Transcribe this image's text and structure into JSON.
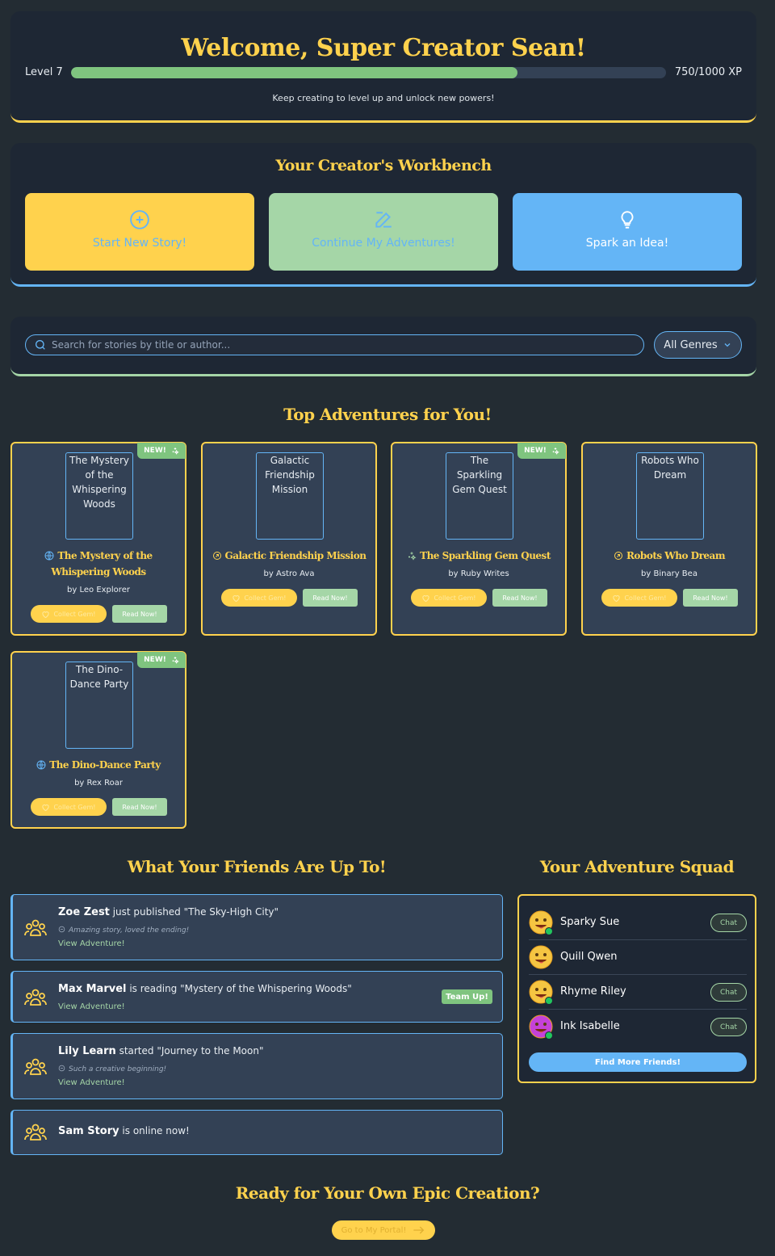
{
  "hero": {
    "title": "Welcome, Super Creator Sean!",
    "level": "Level 7",
    "xp_text": "750/1000 XP",
    "xp_fraction": 0.75,
    "subtitle": "Keep creating to level up and unlock new powers!"
  },
  "workbench": {
    "title": "Your Creator's Workbench",
    "start_label": "Start New Story!",
    "continue_label": "Continue My Adventures!",
    "spark_label": "Spark an Idea!"
  },
  "search": {
    "placeholder": "Search for stories by title or author...",
    "genre": "All Genres"
  },
  "stories": {
    "title": "Top Adventures for You!",
    "new_label": "NEW!",
    "collect_label": "Collect Gem!",
    "read_label": "Read Now!",
    "items": [
      {
        "cover_alt": "The Mystery of the Whispering Woods",
        "title": "The Mystery of the Whispering Woods",
        "author": "by Leo Explorer",
        "is_new": true,
        "icon": "globe-icon"
      },
      {
        "cover_alt": "Galactic Friendship Mission",
        "title": "Galactic Friendship Mission",
        "author": "by Astro Ava",
        "is_new": false,
        "icon": "rocket-icon"
      },
      {
        "cover_alt": "The Sparkling Gem Quest",
        "title": "The Sparkling Gem Quest",
        "author": "by Ruby Writes",
        "is_new": true,
        "icon": "sparkles-icon"
      },
      {
        "cover_alt": "Robots Who Dream",
        "title": "Robots Who Dream",
        "author": "by Binary Bea",
        "is_new": false,
        "icon": "rocket-icon"
      },
      {
        "cover_alt": "The Dino-Dance Party",
        "title": "The Dino-Dance Party",
        "author": "by Rex Roar",
        "is_new": true,
        "icon": "globe-icon"
      }
    ]
  },
  "friends": {
    "title": "What Your Friends Are Up To!",
    "link_label": "View Adventure!",
    "team_up_label": "Team Up!",
    "items": [
      {
        "name": "Zoe Zest",
        "action": " just published \"The Sky-High City\"",
        "comment": "Amazing story, loved the ending!",
        "has_link": true
      },
      {
        "name": "Max Marvel",
        "action": " is reading \"Mystery of the Whispering Woods\"",
        "comment": "",
        "has_link": true
      },
      {
        "name": "Lily Learn",
        "action": " started \"Journey to the Moon\"",
        "comment": "Such a creative beginning!",
        "has_link": true
      },
      {
        "name": "Sam Story",
        "action": " is online now!",
        "comment": "",
        "has_link": false
      }
    ]
  },
  "squad": {
    "title": "Your Adventure Squad",
    "chat_label": "Chat",
    "find_more": "Find More Friends!",
    "members": [
      {
        "name": "Sparky Sue",
        "online": true,
        "avatar_color": "#f5c542"
      },
      {
        "name": "Quill Qwen",
        "online": false,
        "avatar_color": "#f5c542"
      },
      {
        "name": "Rhyme Riley",
        "online": true,
        "avatar_color": "#f5c542"
      },
      {
        "name": "Ink Isabelle",
        "online": true,
        "avatar_color": "#c542d9"
      }
    ]
  },
  "footer": {
    "title": "Ready for Your Own Epic Creation?",
    "portal_label": "Go to My Portal!"
  },
  "colors": {
    "background": "#232c33",
    "panel": "#1e2734",
    "card": "#334155",
    "accent_yellow": "#ffd24d",
    "accent_blue": "#64b5f6",
    "accent_green": "#a5d6a7"
  }
}
